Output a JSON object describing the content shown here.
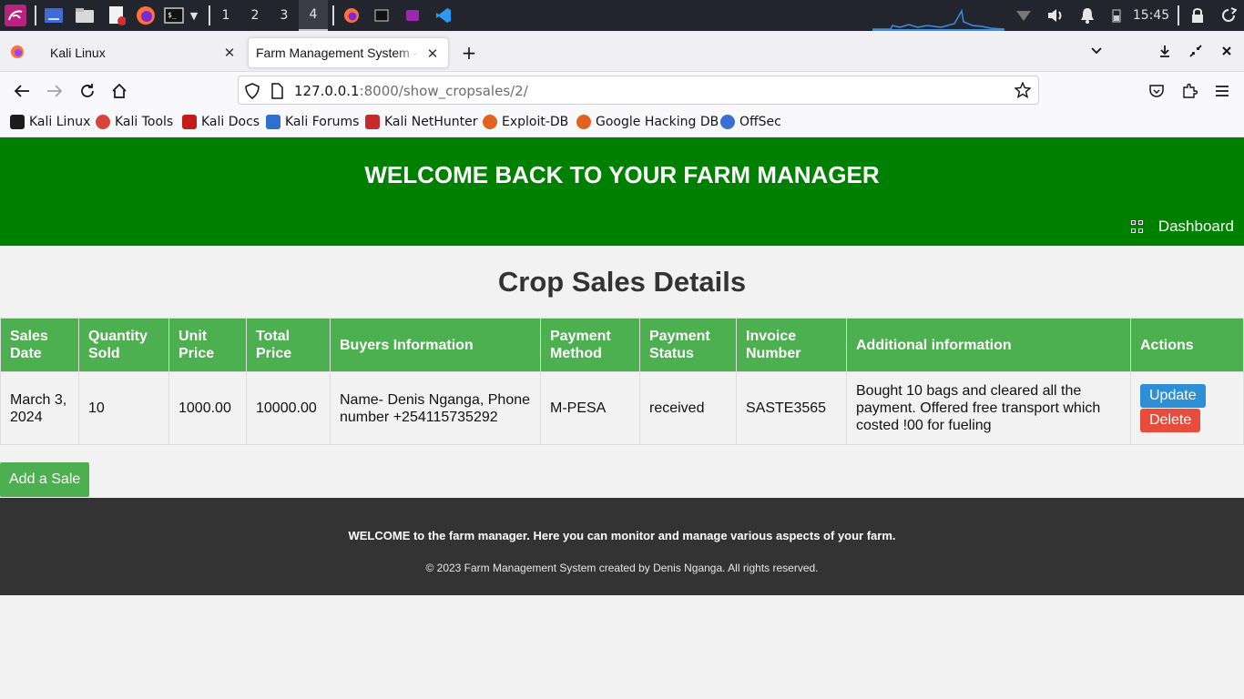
{
  "panel": {
    "workspaces": [
      "1",
      "2",
      "3",
      "4"
    ],
    "active_workspace": "4",
    "clock": "15:45"
  },
  "tabs": [
    {
      "title": "Kali Linux",
      "active": false
    },
    {
      "title": "Farm Management System -",
      "active": true
    }
  ],
  "navbar": {
    "url_host": "127.0.0.1",
    "url_rest": ":8000/show_cropsales/2/"
  },
  "bookmarks": [
    {
      "label": "Kali Linux",
      "color": "#1c1c1c"
    },
    {
      "label": "Kali Tools",
      "color": "#d9443a"
    },
    {
      "label": "Kali Docs",
      "color": "#c41a1a"
    },
    {
      "label": "Kali Forums",
      "color": "#2f6fcf"
    },
    {
      "label": "Kali NetHunter",
      "color": "#c42b2b"
    },
    {
      "label": "Exploit-DB",
      "color": "#e0621f"
    },
    {
      "label": "Google Hacking DB",
      "color": "#e0621f"
    },
    {
      "label": "OffSec",
      "color": "#3a6fd8"
    }
  ],
  "header": {
    "title": "WELCOME BACK TO YOUR FARM MANAGER",
    "dashboard_label": "Dashboard"
  },
  "page_title": "Crop Sales Details",
  "table": {
    "headers": [
      "Sales Date",
      "Quantity Sold",
      "Unit Price",
      "Total Price",
      "Buyers Information",
      "Payment Method",
      "Payment Status",
      "Invoice Number",
      "Additional information",
      "Actions"
    ],
    "rows": [
      {
        "sales_date": "March 3, 2024",
        "quantity": "10",
        "unit_price": "1000.00",
        "total_price": "10000.00",
        "buyer": "Name- Denis Nganga, Phone number +254115735292",
        "payment_method": "M-PESA",
        "payment_status": "received",
        "invoice": "SASTE3565",
        "additional": "Bought 10 bags and cleared all the payment. Offered free transport which costed !00 for fueling",
        "update_label": "Update",
        "delete_label": "Delete"
      }
    ]
  },
  "add_sale_label": "Add a Sale",
  "footer": {
    "line1": "WELCOME to the farm manager. Here you can monitor and manage various aspects of your farm.",
    "line2": "© 2023 Farm Management System created by Denis Nganga. All rights reserved."
  },
  "colors": {
    "header_green": "#008000",
    "table_header_green": "#4caf50",
    "update_blue": "#2f8fd6",
    "delete_red": "#e74c3c",
    "footer_dark": "#333333"
  }
}
